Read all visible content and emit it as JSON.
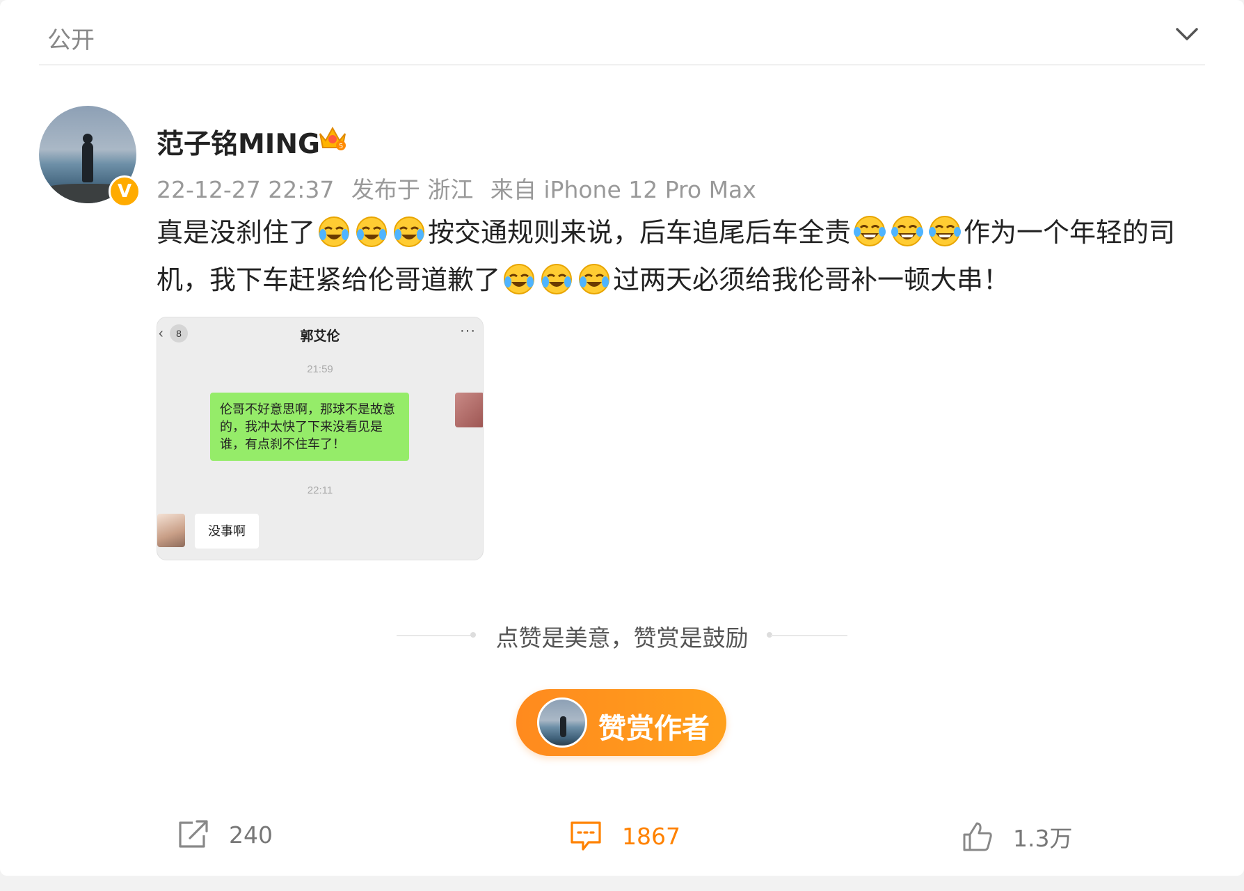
{
  "header": {
    "visibility": "公开"
  },
  "post": {
    "author": "范子铭MING",
    "verified_badge": "V",
    "timestamp": "22-12-27 22:37",
    "location": "发布于 浙江",
    "source": "来自 iPhone 12 Pro Max",
    "text_parts": [
      "真是没刹住了",
      "按交通规则来说，后车追尾后车全责",
      "作为一个年轻的司机，我下车赶紧给伦哥道歉了",
      "过两天必须给我伦哥补一顿大串！"
    ],
    "emojis": {
      "group1": "crying-laughing",
      "group2": "tears-of-joy",
      "group3": "crying-laughing"
    }
  },
  "chat_screenshot": {
    "back_count": "8",
    "contact_name": "郭艾伦",
    "more": "···",
    "time1": "21:59",
    "my_message": "伦哥不好意思啊，那球不是故意的，我冲太快了下来没看见是谁，有点刹不住车了！",
    "time2": "22:11",
    "reply": "没事啊"
  },
  "reward": {
    "tagline": "点赞是美意，赞赏是鼓励",
    "button_label": "赞赏作者"
  },
  "actions": {
    "share_count": "240",
    "comment_count": "1867",
    "like_count": "1.3万"
  },
  "colors": {
    "accent": "#ff8200",
    "badge": "#ffab00",
    "chat_green": "#95ec69"
  }
}
